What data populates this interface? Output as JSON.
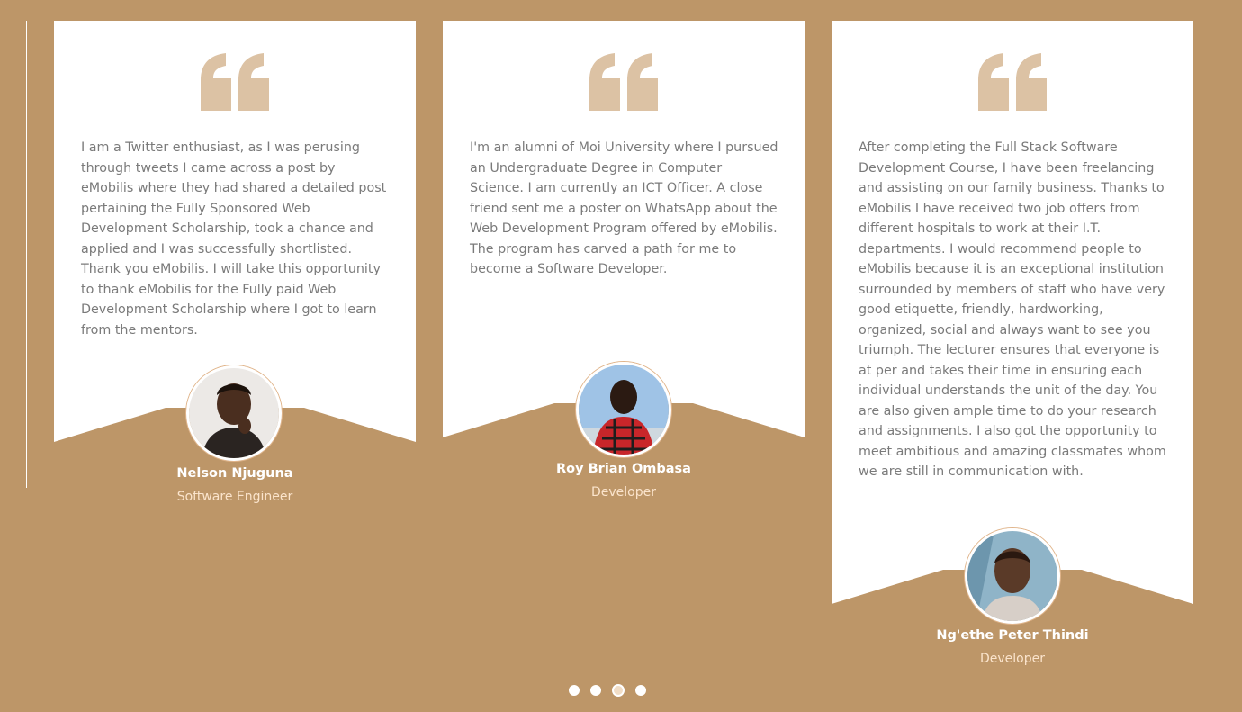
{
  "testimonials": [
    {
      "text": "I am a Twitter enthusiast, as I was perusing through tweets I came across a post by eMobilis where they had shared a detailed post pertaining the Fully Sponsored Web Development Scholarship, took a chance and applied and I was successfully shortlisted. Thank you eMobilis. I will take this opportunity to thank eMobilis for the Fully paid Web Development Scholarship where I got to learn from the mentors.",
      "name": "Nelson Njuguna",
      "role": "Software Engineer",
      "avatar_icon": "person-photo"
    },
    {
      "text": "I'm an alumni of Moi University where I pursued an Undergraduate Degree in Computer Science. I am currently an ICT Officer. A close friend sent me a poster on WhatsApp about the Web Development Program offered by eMobilis. The program has carved a path for me to become a Software Developer.",
      "name": "Roy Brian Ombasa",
      "role": "Developer",
      "avatar_icon": "person-photo"
    },
    {
      "text": "After completing the Full Stack Software Development Course, I have been freelancing and assisting on our family business. Thanks to eMobilis I have received two job offers from different hospitals to work at their I.T. departments. I would recommend people to eMobilis because it is an exceptional institution surrounded by members of staff who have very good etiquette, friendly, hardworking, organized, social and always want to see you triumph. The lecturer ensures that everyone is at per and takes their time in ensuring each individual understands the unit of the day. You are also given ample time to do your research and assignments. I also got the opportunity to meet ambitious and amazing classmates whom we are still in communication with.",
      "name": "Ng'ethe Peter Thindi",
      "role": "Developer",
      "avatar_icon": "person-photo"
    }
  ],
  "carousel": {
    "dot_count": 4,
    "active_index": 2
  },
  "colors": {
    "background": "#bd9668",
    "quote_icon": "#dcc2a4",
    "role_text": "#fbe4cc"
  }
}
